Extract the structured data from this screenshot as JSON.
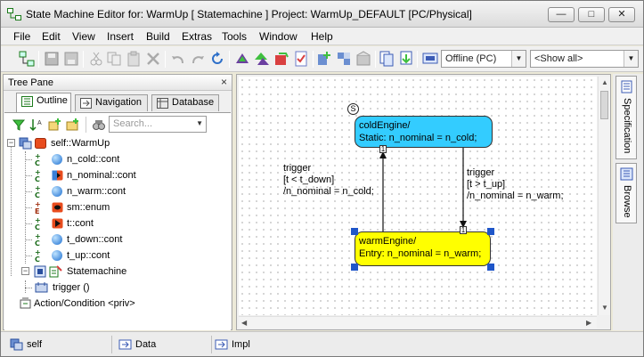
{
  "window": {
    "title": "State Machine Editor for: WarmUp [ Statemachine ] Project: WarmUp_DEFAULT [PC/Physical]",
    "minimize": "—",
    "maximize": "□",
    "close": "✕"
  },
  "menu": [
    "File",
    "Edit",
    "View",
    "Insert",
    "Build",
    "Extras",
    "Tools",
    "Window",
    "Help"
  ],
  "toolbar": {
    "mode_select": "Offline (PC)",
    "show_select": "<Show all>"
  },
  "tree_pane": {
    "title": "Tree Pane",
    "close": "×",
    "tabs": [
      "Outline",
      "Navigation",
      "Database"
    ],
    "search_placeholder": "Search...",
    "items": [
      {
        "label": "self::WarmUp"
      },
      {
        "label": "n_cold::cont",
        "tag": "C"
      },
      {
        "label": "n_nominal::cont",
        "tag": "C"
      },
      {
        "label": "n_warm::cont",
        "tag": "C"
      },
      {
        "label": "sm::enum",
        "tag": "E"
      },
      {
        "label": "t::cont",
        "tag": "C"
      },
      {
        "label": "t_down::cont",
        "tag": "C"
      },
      {
        "label": "t_up::cont",
        "tag": "C"
      },
      {
        "label": "Statemachine"
      },
      {
        "label": "trigger ()"
      },
      {
        "label": "Action/Condition <priv>"
      }
    ]
  },
  "diagram": {
    "init_marker": "S",
    "states": [
      {
        "name": "coldEngine/",
        "action": "Static: n_nominal = n_cold;",
        "color": "#33ccff"
      },
      {
        "name": "warmEngine/",
        "action": "Entry: n_nominal = n_warm;",
        "color": "#ffff00"
      }
    ],
    "transitions": [
      {
        "line1": "trigger",
        "line2": "[t < t_down]",
        "line3": "/n_nominal = n_cold;",
        "priority": "1"
      },
      {
        "line1": "trigger",
        "line2": "[t > t_up]",
        "line3": "/n_nominal = n_warm;",
        "priority": "1"
      }
    ]
  },
  "side_tabs": [
    "Specification",
    "Browse"
  ],
  "status_bar": [
    "self",
    "Data",
    "Impl"
  ]
}
